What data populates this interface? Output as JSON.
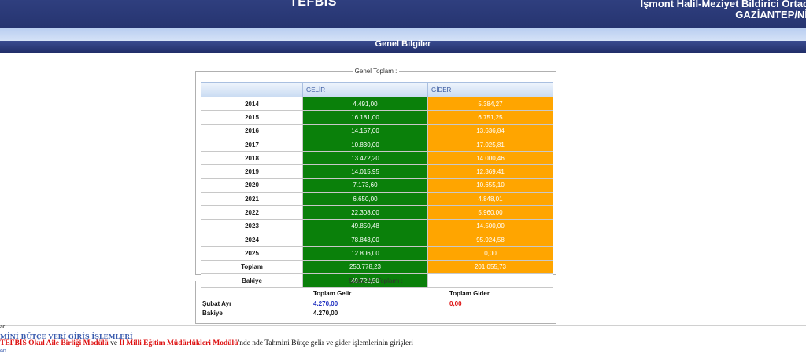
{
  "header": {
    "app_title": "TEFBİS",
    "school_name": "İşmont Halil-Meziyet Bildirici Ortao",
    "school_location": "GAZİANTEP/Nİ"
  },
  "section": {
    "title": "Genel Bilgiler"
  },
  "genel_toplam": {
    "legend": "Genel Toplam :",
    "col_gelir": "GELİR",
    "col_gider": "GİDER",
    "rows": [
      {
        "year": "2014",
        "gelir": "4.491,00",
        "gider": "5.384,27"
      },
      {
        "year": "2015",
        "gelir": "16.181,00",
        "gider": "6.751,25"
      },
      {
        "year": "2016",
        "gelir": "14.157,00",
        "gider": "13.636,84"
      },
      {
        "year": "2017",
        "gelir": "10.830,00",
        "gider": "17.025,81"
      },
      {
        "year": "2018",
        "gelir": "13.472,20",
        "gider": "14.000,46"
      },
      {
        "year": "2019",
        "gelir": "14.015,95",
        "gider": "12.369,41"
      },
      {
        "year": "2020",
        "gelir": "7.173,60",
        "gider": "10.655,10"
      },
      {
        "year": "2021",
        "gelir": "6.650,00",
        "gider": "4.848,01"
      },
      {
        "year": "2022",
        "gelir": "22.308,00",
        "gider": "5.960,00"
      },
      {
        "year": "2023",
        "gelir": "49.850,48",
        "gider": "14.500,00"
      },
      {
        "year": "2024",
        "gelir": "78.843,00",
        "gider": "95.924,58"
      },
      {
        "year": "2025",
        "gelir": "12.806,00",
        "gider": "0,00"
      }
    ],
    "toplam": {
      "label": "Toplam",
      "gelir": "250.778,23",
      "gider": "201.055,73"
    },
    "bakiye": {
      "label": "Bakiye",
      "value": "49.722,50"
    }
  },
  "subat": {
    "legend": "Şubat Ayı Toplamı :",
    "col_gelir": "Toplam Gelir",
    "col_gider": "Toplam Gider",
    "row_label": "Şubat Ayı",
    "gelir": "4.270,00",
    "gider": "0,00",
    "bakiye_label": "Bakiye",
    "bakiye": "4.270,00"
  },
  "bottom": {
    "fragment": "ar",
    "title": "MİNİ BÜTÇE VERİ GİRİŞ İŞLEMLERİ",
    "text_part1": "TEFBİS Okul Aile Birliği Modülü",
    "text_part2": " ve ",
    "text_part3": "İl Milli Eğitim Müdürlükleri Modülü",
    "text_part4": "'nde nde Tahmini Bütçe gelir ve gider işlemlerinin girişleri",
    "link": "an"
  },
  "colors": {
    "header_bg": "#263470",
    "gelir_green": "#0a800a",
    "gider_orange": "#ffa500",
    "link_blue": "#3b5cae",
    "highlight_red": "#dd1111"
  }
}
